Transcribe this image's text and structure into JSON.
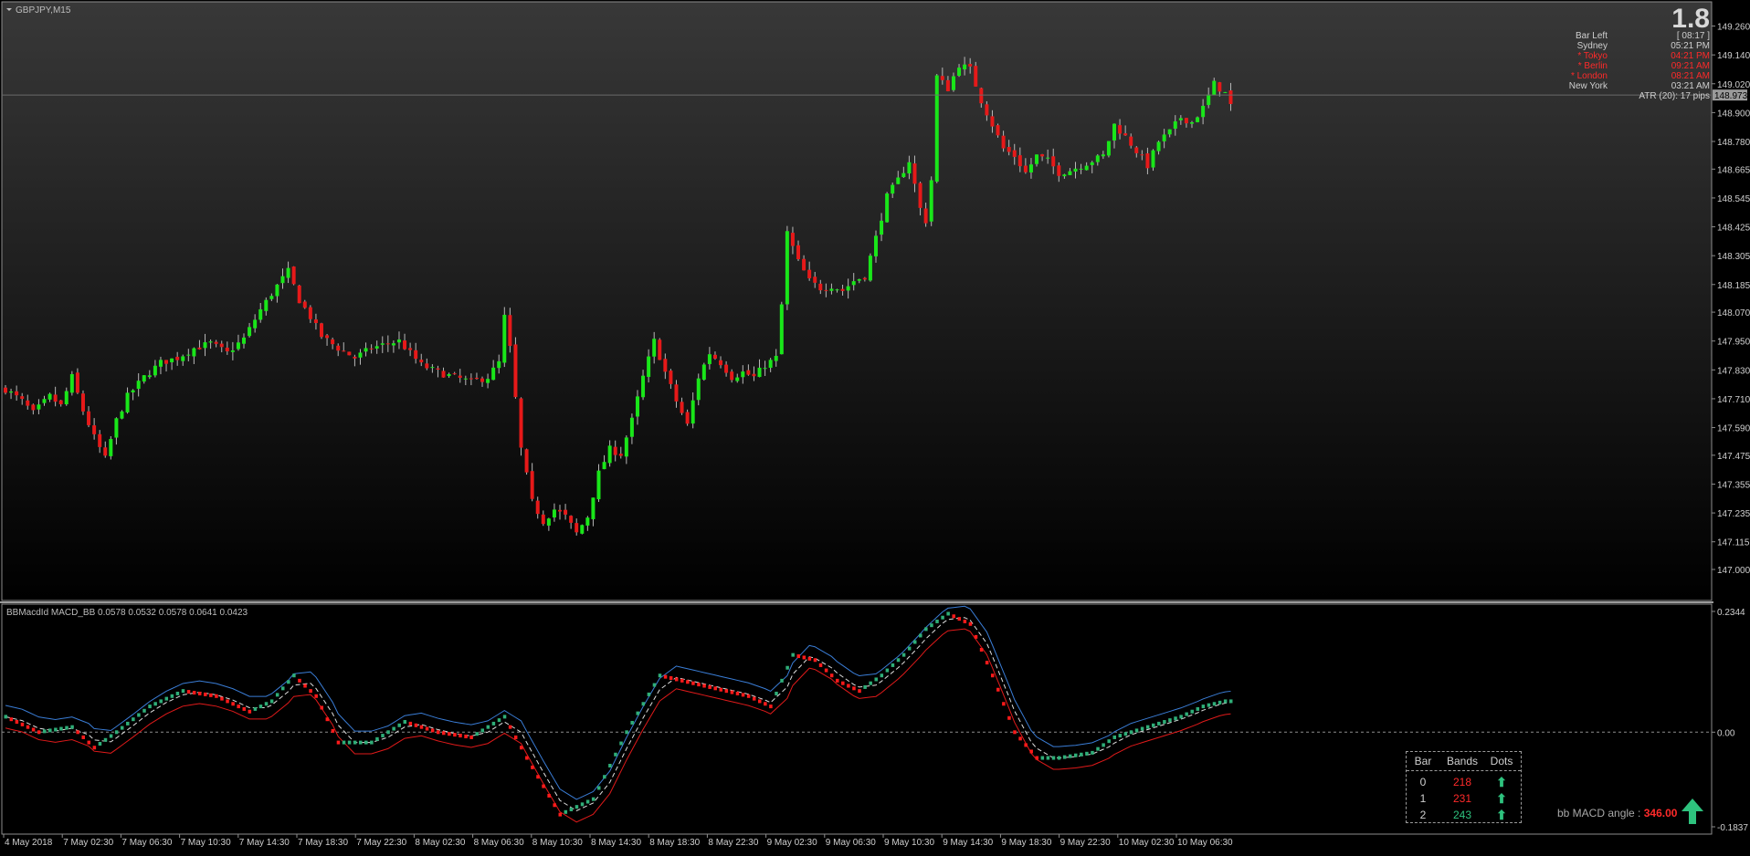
{
  "window": {
    "symbol_title": "GBPJPY,M15",
    "indicator_title": "BBMacdId MACD_BB 0.0578 0.0532 0.0578 0.0641 0.0423"
  },
  "info_panel": {
    "spread": "1.8",
    "bar_left_label": "Bar Left",
    "bar_left_value": "[ 08:17 ]",
    "sessions": [
      {
        "name": "Sydney",
        "time": "05:21 PM",
        "active": false
      },
      {
        "name": "* Tokyo",
        "time": "04:21 PM",
        "active": true
      },
      {
        "name": "* Berlin",
        "time": "09:21 AM",
        "active": true
      },
      {
        "name": "* London",
        "time": "08:21 AM",
        "active": true
      },
      {
        "name": "New York",
        "time": "03:21 AM",
        "active": false
      }
    ],
    "atr": "ATR (20): 17 pips"
  },
  "colors": {
    "bull": "#19e619",
    "bear": "#e61919",
    "wick": "#b8b8b8",
    "dot_up": "#2fae78",
    "dot_down": "#ff1a1a",
    "upper_band": "#3a7dd6",
    "lower_band": "#e01a1a",
    "mid_line": "#dddddd",
    "axis_text": "#cfcfcf"
  },
  "bands_table": {
    "headers": [
      "Bar",
      "Bands",
      "Dots"
    ],
    "rows": [
      {
        "bar": "0",
        "bands": "218",
        "bands_color": "#ff2a2a",
        "dots": "up-arrow-icon"
      },
      {
        "bar": "1",
        "bands": "231",
        "bands_color": "#ff2a2a",
        "dots": "up-arrow-icon"
      },
      {
        "bar": "2",
        "bands": "243",
        "bands_color": "#2ec27e",
        "dots": "up-arrow-icon"
      }
    ]
  },
  "macd_angle": {
    "label": "bb MACD angle :",
    "value": "346.00"
  },
  "chart_data": [
    {
      "type": "candlestick",
      "title": "GBPJPY,M15",
      "ylim": [
        147.0,
        149.3
      ],
      "y_ticks": [
        "149.260",
        "149.140",
        "149.020",
        "148.900",
        "148.780",
        "148.665",
        "148.545",
        "148.425",
        "148.305",
        "148.185",
        "148.070",
        "147.950",
        "147.830",
        "147.710",
        "147.590",
        "147.475",
        "147.355",
        "147.235",
        "147.115",
        "147.000"
      ],
      "current_price": "148.973",
      "x_ticks": [
        "4 May 2018",
        "7 May 02:30",
        "7 May 06:30",
        "7 May 10:30",
        "7 May 14:30",
        "7 May 18:30",
        "7 May 22:30",
        "8 May 02:30",
        "8 May 06:30",
        "8 May 10:30",
        "8 May 14:30",
        "8 May 18:30",
        "8 May 22:30",
        "9 May 02:30",
        "9 May 06:30",
        "9 May 10:30",
        "9 May 14:30",
        "9 May 18:30",
        "9 May 22:30",
        "10 May 02:30",
        "10 May 06:30"
      ],
      "close_path": [
        [
          0,
          147.75
        ],
        [
          3,
          147.7
        ],
        [
          5,
          147.65
        ],
        [
          8,
          147.72
        ],
        [
          10,
          147.68
        ],
        [
          12,
          147.8
        ],
        [
          14,
          147.66
        ],
        [
          16,
          147.55
        ],
        [
          18,
          147.46
        ],
        [
          20,
          147.62
        ],
        [
          22,
          147.72
        ],
        [
          25,
          147.8
        ],
        [
          28,
          147.86
        ],
        [
          31,
          147.88
        ],
        [
          34,
          147.92
        ],
        [
          37,
          147.94
        ],
        [
          40,
          147.9
        ],
        [
          43,
          147.96
        ],
        [
          46,
          148.08
        ],
        [
          49,
          148.18
        ],
        [
          51,
          148.24
        ],
        [
          53,
          148.12
        ],
        [
          55,
          148.05
        ],
        [
          57,
          147.97
        ],
        [
          60,
          147.92
        ],
        [
          63,
          147.88
        ],
        [
          66,
          147.92
        ],
        [
          69,
          147.94
        ],
        [
          71,
          147.95
        ],
        [
          73,
          147.9
        ],
        [
          75,
          147.85
        ],
        [
          78,
          147.82
        ],
        [
          81,
          147.8
        ],
        [
          84,
          147.78
        ],
        [
          87,
          147.8
        ],
        [
          89,
          147.86
        ],
        [
          90,
          148.05
        ],
        [
          91,
          147.92
        ],
        [
          93,
          147.5
        ],
        [
          95,
          147.28
        ],
        [
          97,
          147.2
        ],
        [
          99,
          147.25
        ],
        [
          101,
          147.22
        ],
        [
          103,
          147.15
        ],
        [
          105,
          147.22
        ],
        [
          107,
          147.4
        ],
        [
          109,
          147.5
        ],
        [
          111,
          147.48
        ],
        [
          113,
          147.62
        ],
        [
          115,
          147.8
        ],
        [
          117,
          147.95
        ],
        [
          119,
          147.82
        ],
        [
          121,
          147.7
        ],
        [
          123,
          147.6
        ],
        [
          125,
          147.8
        ],
        [
          127,
          147.9
        ],
        [
          129,
          147.86
        ],
        [
          131,
          147.8
        ],
        [
          133,
          147.82
        ],
        [
          135,
          147.8
        ],
        [
          137,
          147.85
        ],
        [
          139,
          147.88
        ],
        [
          140,
          148.1
        ],
        [
          141,
          148.4
        ],
        [
          143,
          148.28
        ],
        [
          145,
          148.2
        ],
        [
          147,
          148.17
        ],
        [
          149,
          148.18
        ],
        [
          151,
          148.16
        ],
        [
          153,
          148.2
        ],
        [
          155,
          148.22
        ],
        [
          157,
          148.38
        ],
        [
          159,
          148.55
        ],
        [
          161,
          148.62
        ],
        [
          163,
          148.7
        ],
        [
          165,
          148.5
        ],
        [
          166,
          148.45
        ],
        [
          167,
          148.62
        ],
        [
          168,
          149.05
        ],
        [
          170,
          149.0
        ],
        [
          172,
          149.1
        ],
        [
          174,
          149.08
        ],
        [
          176,
          148.95
        ],
        [
          178,
          148.85
        ],
        [
          180,
          148.75
        ],
        [
          182,
          148.72
        ],
        [
          184,
          148.65
        ],
        [
          186,
          148.72
        ],
        [
          188,
          148.7
        ],
        [
          190,
          148.65
        ],
        [
          192,
          148.66
        ],
        [
          194,
          148.68
        ],
        [
          196,
          148.7
        ],
        [
          198,
          148.72
        ],
        [
          200,
          148.85
        ],
        [
          202,
          148.8
        ],
        [
          204,
          148.74
        ],
        [
          206,
          148.68
        ],
        [
          208,
          148.78
        ],
        [
          210,
          148.82
        ],
        [
          212,
          148.88
        ],
        [
          214,
          148.86
        ],
        [
          216,
          148.92
        ],
        [
          218,
          149.02
        ],
        [
          220,
          148.98
        ],
        [
          221,
          148.93
        ]
      ]
    },
    {
      "type": "line",
      "title": "BBMacdId MACD_BB 0.0578 0.0532 0.0578 0.0641 0.0423",
      "ylim": [
        -0.1837,
        0.2344
      ],
      "y_ticks": [
        "0.2344",
        "0.00",
        "-0.1837"
      ],
      "x_ticks": [
        "4 May 2018",
        "7 May 02:30",
        "7 May 06:30",
        "7 May 10:30",
        "7 May 14:30",
        "7 May 18:30",
        "7 May 22:30",
        "8 May 02:30",
        "8 May 06:30",
        "8 May 10:30",
        "8 May 14:30",
        "8 May 18:30",
        "8 May 22:30",
        "9 May 02:30",
        "9 May 06:30",
        "9 May 10:30",
        "9 May 14:30",
        "9 May 18:30",
        "9 May 22:30",
        "10 May 02:30",
        "10 May 06:30"
      ],
      "macd": [
        [
          0,
          0.03
        ],
        [
          6,
          0.0
        ],
        [
          12,
          0.01
        ],
        [
          16,
          -0.03
        ],
        [
          20,
          0.0
        ],
        [
          26,
          0.05
        ],
        [
          32,
          0.08
        ],
        [
          38,
          0.07
        ],
        [
          44,
          0.04
        ],
        [
          48,
          0.06
        ],
        [
          52,
          0.11
        ],
        [
          56,
          0.07
        ],
        [
          60,
          -0.02
        ],
        [
          66,
          -0.02
        ],
        [
          72,
          0.02
        ],
        [
          78,
          0.0
        ],
        [
          84,
          -0.01
        ],
        [
          90,
          0.03
        ],
        [
          94,
          -0.05
        ],
        [
          100,
          -0.16
        ],
        [
          106,
          -0.13
        ],
        [
          112,
          0.0
        ],
        [
          118,
          0.11
        ],
        [
          122,
          0.1
        ],
        [
          126,
          0.09
        ],
        [
          130,
          0.08
        ],
        [
          134,
          0.07
        ],
        [
          138,
          0.05
        ],
        [
          142,
          0.15
        ],
        [
          146,
          0.14
        ],
        [
          150,
          0.1
        ],
        [
          154,
          0.08
        ],
        [
          158,
          0.11
        ],
        [
          162,
          0.15
        ],
        [
          166,
          0.2
        ],
        [
          170,
          0.23
        ],
        [
          174,
          0.21
        ],
        [
          178,
          0.11
        ],
        [
          182,
          0.0
        ],
        [
          186,
          -0.05
        ],
        [
          190,
          -0.05
        ],
        [
          196,
          -0.04
        ],
        [
          200,
          -0.01
        ],
        [
          206,
          0.01
        ],
        [
          212,
          0.03
        ],
        [
          216,
          0.05
        ],
        [
          220,
          0.06
        ]
      ]
    }
  ]
}
